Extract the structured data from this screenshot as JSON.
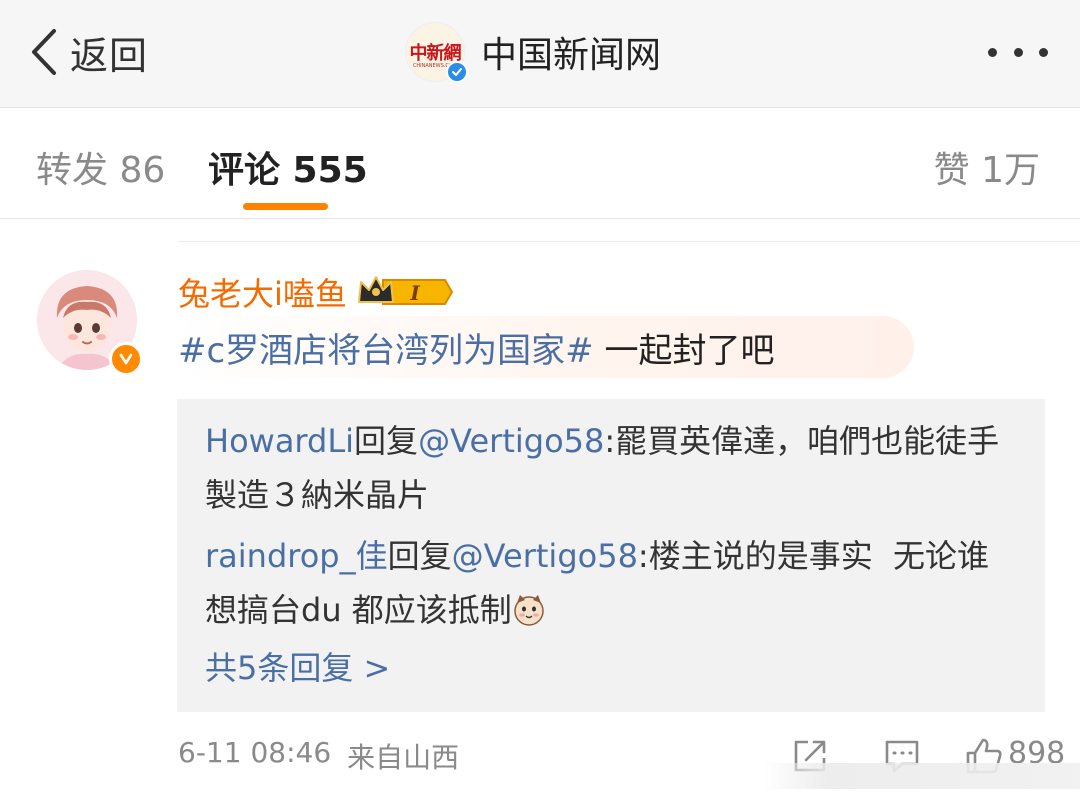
{
  "header": {
    "back_label": "返回",
    "title": "中国新闻网",
    "logo_text": "中新網",
    "logo_subtext": "CHINANEWS.COM"
  },
  "tabs": {
    "repost": "转发 86",
    "comment": "评论 555",
    "like": "赞 1万"
  },
  "comment": {
    "username": "兔老大i嗑鱼",
    "vip_level": "I",
    "hashtag": "#c罗酒店将台湾列为国家#",
    "text": " 一起封了吧",
    "timestamp": "6-11 08:46",
    "source": "来自山西",
    "like_count": "898"
  },
  "replies": [
    {
      "user": "HowardLi",
      "reply_word": "回复",
      "mention": "@Vertigo58",
      "text": ":罷買英偉達，咱們也能徒手製造３納米晶片"
    },
    {
      "user": "raindrop_佳",
      "reply_word": "回复",
      "mention": "@Vertigo58",
      "text": ":楼主说的是事实  无论谁想搞台du 都应该抵制"
    }
  ],
  "more_replies": "共5条回复 >",
  "colors": {
    "accent_orange": "#ff8200",
    "username_orange": "#f66a00",
    "link_blue": "#4a6fa5",
    "verify_blue": "#2a8ee8"
  }
}
